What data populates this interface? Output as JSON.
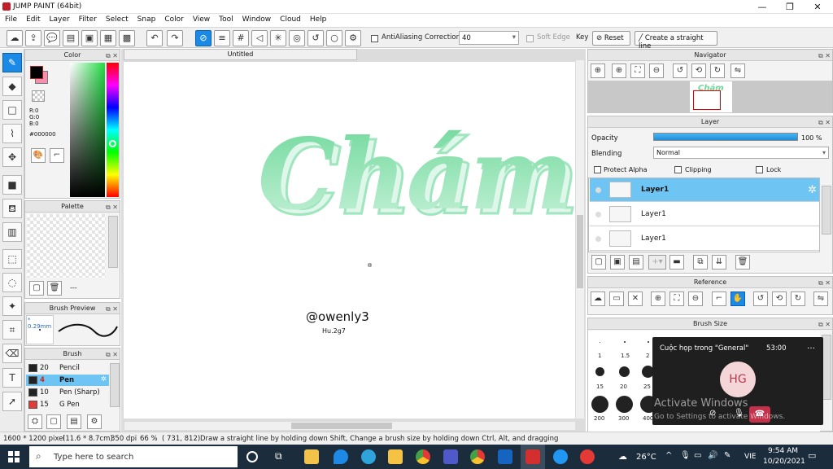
{
  "window": {
    "title": "JUMP PAINT (64bit)"
  },
  "menu": [
    "File",
    "Edit",
    "Layer",
    "Filter",
    "Select",
    "Snap",
    "Color",
    "View",
    "Tool",
    "Window",
    "Cloud",
    "Help"
  ],
  "toolbar": {
    "antialiasing_label": "AntiAliasing",
    "correction_label": "Correction",
    "correction_value": "40",
    "soft_edge_label": "Soft Edge",
    "key_label": "Key",
    "reset_label": "Reset",
    "straight_line_label": "Create a straight line"
  },
  "color_panel": {
    "title": "Color",
    "r": "R:0",
    "g": "G:0",
    "b": "B:0",
    "hex": "#000000",
    "primary_color": "#000000",
    "secondary_color": "#f48fb1"
  },
  "palette_panel": {
    "title": "Palette",
    "dots": "---"
  },
  "brush_preview": {
    "title": "Brush Preview",
    "size": "* 0.29mm"
  },
  "brush_panel": {
    "title": "Brush",
    "items": [
      {
        "size": "20",
        "name": "Pencil",
        "color": "#222222"
      },
      {
        "size": "4",
        "name": "Pen",
        "color": "#222222",
        "selected": true
      },
      {
        "size": "10",
        "name": "Pen (Sharp)",
        "color": "#222222"
      },
      {
        "size": "15",
        "name": "G Pen",
        "color": "#e53935"
      }
    ]
  },
  "canvas": {
    "tab": "Untitled",
    "artwork_text": "Chám",
    "signature": "@owenly3",
    "signature_sub": "Hu.2g7"
  },
  "navigator": {
    "title": "Navigator",
    "thumb_text": "Chám"
  },
  "layer_panel": {
    "title": "Layer",
    "opacity_label": "Opacity",
    "opacity_value": "100 %",
    "opacity_fraction": 1.0,
    "blending_label": "Blending",
    "blending_value": "Normal",
    "protect_alpha": "Protect Alpha",
    "clipping": "Clipping",
    "lock": "Lock",
    "layers": [
      "Layer1",
      "Layer1",
      "Layer1"
    ]
  },
  "reference_panel": {
    "title": "Reference"
  },
  "brush_size_panel": {
    "title": "Brush Size",
    "labels_row1": [
      "1",
      "1.5",
      "2"
    ],
    "labels_row2": [
      "15",
      "20",
      "25"
    ],
    "labels_row3": [
      "200",
      "300",
      "400"
    ]
  },
  "teams_call": {
    "title": "Cuộc họp trong \"General\"",
    "timer": "53:00",
    "avatar": "HG",
    "activate_line1": "Activate Windows",
    "activate_line2": "Go to Settings to activate Windows."
  },
  "statusbar": {
    "size": "1600 * 1200 pixel",
    "cm": "(11.6 * 8.7cm)",
    "dpi": "350 dpi",
    "zoom": "66 %",
    "coords": "( 731, 812)",
    "hint": "Draw a straight line by holding down Shift, Change a brush size by holding down Ctrl, Alt, and dragging"
  },
  "taskbar": {
    "search_placeholder": "Type here to search",
    "weather": "26°C",
    "lang": "VIE",
    "time": "9:54 AM",
    "date": "10/20/2021"
  }
}
